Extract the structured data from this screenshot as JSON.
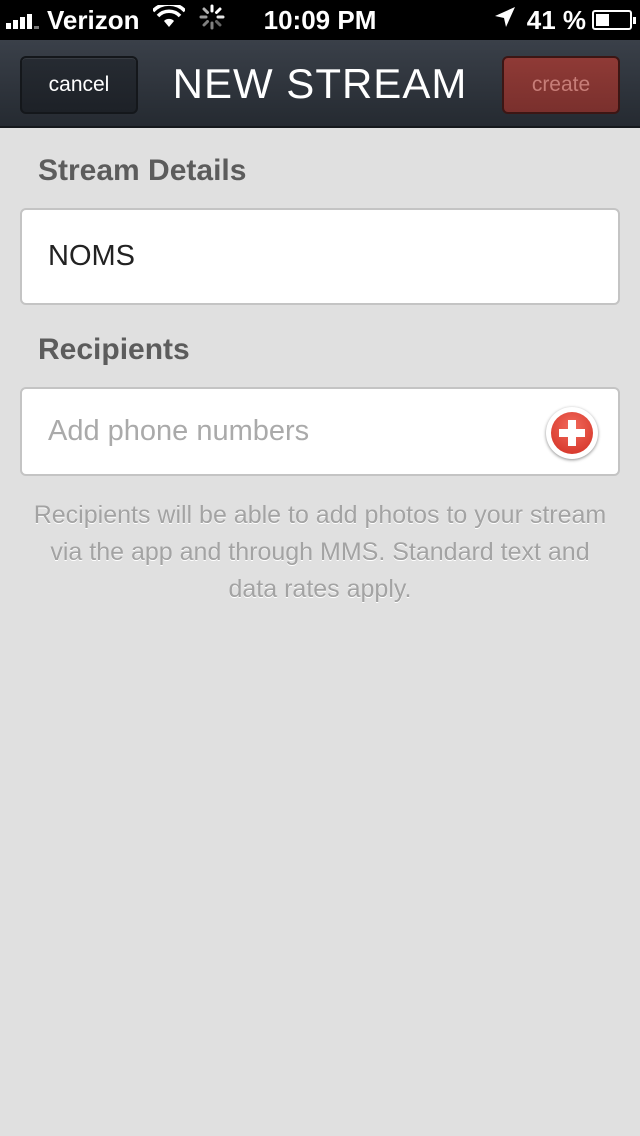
{
  "status_bar": {
    "carrier": "Verizon",
    "time": "10:09 PM",
    "battery": "41 %",
    "battery_level": 0.41,
    "icons": [
      "signal-icon",
      "wifi-icon",
      "activity-spinner-icon",
      "location-arrow-icon",
      "battery-icon"
    ]
  },
  "nav": {
    "cancel_label": "cancel",
    "title": "NEW STREAM",
    "create_label": "create"
  },
  "stream_details": {
    "label": "Stream Details",
    "name_value": "NOMS"
  },
  "recipients": {
    "label": "Recipients",
    "placeholder": "Add phone numbers",
    "add_icon": "add-circle-icon",
    "note": "Recipients will be able to add photos to your stream via the app and through MMS. Standard text and data rates apply."
  },
  "colors": {
    "background": "#e0e0e0",
    "nav_bar": "#2f343c",
    "create_button": "#8f3a36",
    "add_button": "#d12e22"
  }
}
